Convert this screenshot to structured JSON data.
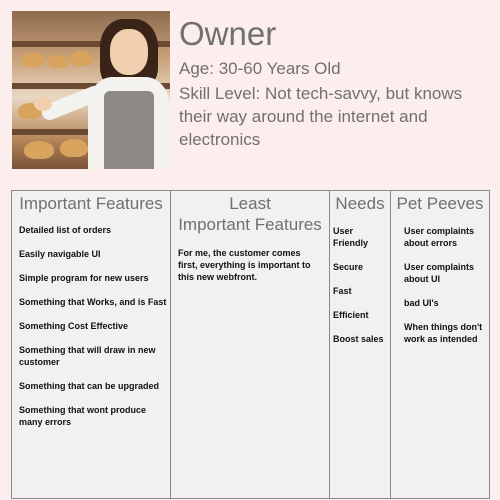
{
  "persona": {
    "title": "Owner",
    "age": "Age: 30-60 Years Old",
    "skill": "Skill Level: Not tech-savvy, but knows their way around the internet and electronics"
  },
  "columns": {
    "important": {
      "header": "Important Features",
      "items": [
        "Detailed list of orders",
        "Easily navigable UI",
        "Simple program for new users",
        "Something that Works, and is Fast",
        "Something Cost Effective",
        "Something that will draw in new customer",
        "Something that can be upgraded",
        "Something that wont produce many errors"
      ]
    },
    "least": {
      "header_line1": "Least",
      "header_line2": "Important Features",
      "items": [
        "For me, the customer comes first, everything is important to this new webfront."
      ]
    },
    "needs": {
      "header": "Needs",
      "items": [
        "User Friendly",
        "Secure",
        "Fast",
        "Efficient",
        "Boost sales"
      ]
    },
    "peeves": {
      "header": "Pet Peeves",
      "items": [
        "User complaints about errors",
        "User complaints about UI",
        "bad UI's",
        "When things don't work as intended"
      ]
    }
  }
}
